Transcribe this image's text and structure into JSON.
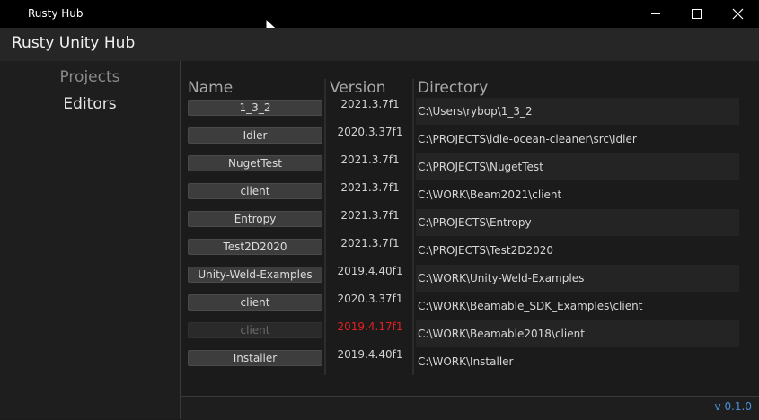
{
  "window": {
    "title": "Rusty Hub",
    "controls": [
      "minimize-icon",
      "maximize-icon",
      "close-icon"
    ]
  },
  "app": {
    "title": "Rusty Unity Hub"
  },
  "sidebar": {
    "items": [
      {
        "label": "Projects",
        "state": "inactive"
      },
      {
        "label": "Editors",
        "state": "active"
      }
    ]
  },
  "table": {
    "headers": {
      "name": "Name",
      "version": "Version",
      "directory": "Directory"
    },
    "rows": [
      {
        "name": "1_3_2",
        "version": "2021.3.7f1",
        "directory": "C:\\Users\\rybop\\1_3_2",
        "available": true
      },
      {
        "name": "Idler",
        "version": "2020.3.37f1",
        "directory": "C:\\PROJECTS\\idle-ocean-cleaner\\src\\Idler",
        "available": true
      },
      {
        "name": "NugetTest",
        "version": "2021.3.7f1",
        "directory": "C:\\PROJECTS\\NugetTest",
        "available": true
      },
      {
        "name": "client",
        "version": "2021.3.7f1",
        "directory": "C:\\WORK\\Beam2021\\client",
        "available": true
      },
      {
        "name": "Entropy",
        "version": "2021.3.7f1",
        "directory": "C:\\PROJECTS\\Entropy",
        "available": true
      },
      {
        "name": "Test2D2020",
        "version": "2021.3.7f1",
        "directory": "C:\\PROJECTS\\Test2D2020",
        "available": true
      },
      {
        "name": "Unity-Weld-Examples",
        "version": "2019.4.40f1",
        "directory": "C:\\WORK\\Unity-Weld-Examples",
        "available": true
      },
      {
        "name": "client",
        "version": "2020.3.37f1",
        "directory": "C:\\WORK\\Beamable_SDK_Examples\\client",
        "available": true
      },
      {
        "name": "client",
        "version": "2019.4.17f1",
        "directory": "C:\\WORK\\Beamable2018\\client",
        "available": false
      },
      {
        "name": "Installer",
        "version": "2019.4.40f1",
        "directory": "C:\\WORK\\Installer",
        "available": true
      }
    ]
  },
  "footer": {
    "version": "v 0.1.0"
  },
  "colors": {
    "accent": "#4a90d9",
    "missing_version": "#e02020",
    "background": "#1b1b1b"
  }
}
